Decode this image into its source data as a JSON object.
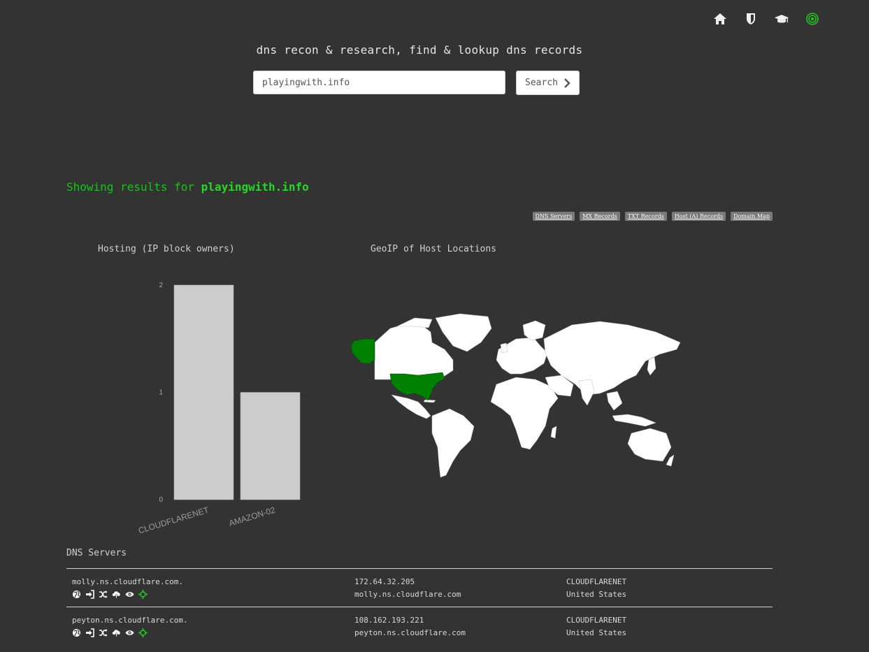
{
  "nav": {
    "icons": [
      "home-icon",
      "shield-icon",
      "graduation-cap-icon",
      "target-icon"
    ],
    "active_color": "#22c422"
  },
  "tagline": "dns recon & research, find & lookup dns records",
  "search": {
    "value": "playingwith.info",
    "button_label": "Search"
  },
  "results": {
    "prefix": "Showing results for",
    "domain": "playingwith.info"
  },
  "tabs": [
    "DNS Servers",
    "MX Records",
    "TXT Records",
    "Host (A) Records",
    "Domain Map"
  ],
  "hosting": {
    "title": "Hosting (IP block owners)"
  },
  "geo": {
    "title": "GeoIP of Host Locations",
    "highlight_country": "United States",
    "highlight_color": "#008000"
  },
  "chart_data": {
    "type": "bar",
    "categories": [
      "CLOUDFLARENET",
      "AMAZON-02"
    ],
    "values": [
      2,
      1
    ],
    "title": "Hosting (IP block owners)",
    "ylim": [
      0,
      2
    ],
    "yticks": [
      "0",
      "1",
      "2"
    ],
    "bar_color": "#cccccc"
  },
  "dns_section": {
    "title": "DNS Servers",
    "rows": [
      {
        "name": "molly.ns.cloudflare.com.",
        "ip": "172.64.32.205",
        "reverse": "molly.ns.cloudflare.com",
        "asn": "CLOUDFLARENET",
        "country": "United States"
      },
      {
        "name": "peyton.ns.cloudflare.com.",
        "ip": "108.162.193.221",
        "reverse": "peyton.ns.cloudflare.com",
        "asn": "CLOUDFLARENET",
        "country": "United States"
      }
    ],
    "action_icons": [
      "globe-icon",
      "sign-in-icon",
      "random-icon",
      "cloud-upload-icon",
      "eye-icon",
      "crosshairs-icon"
    ]
  }
}
